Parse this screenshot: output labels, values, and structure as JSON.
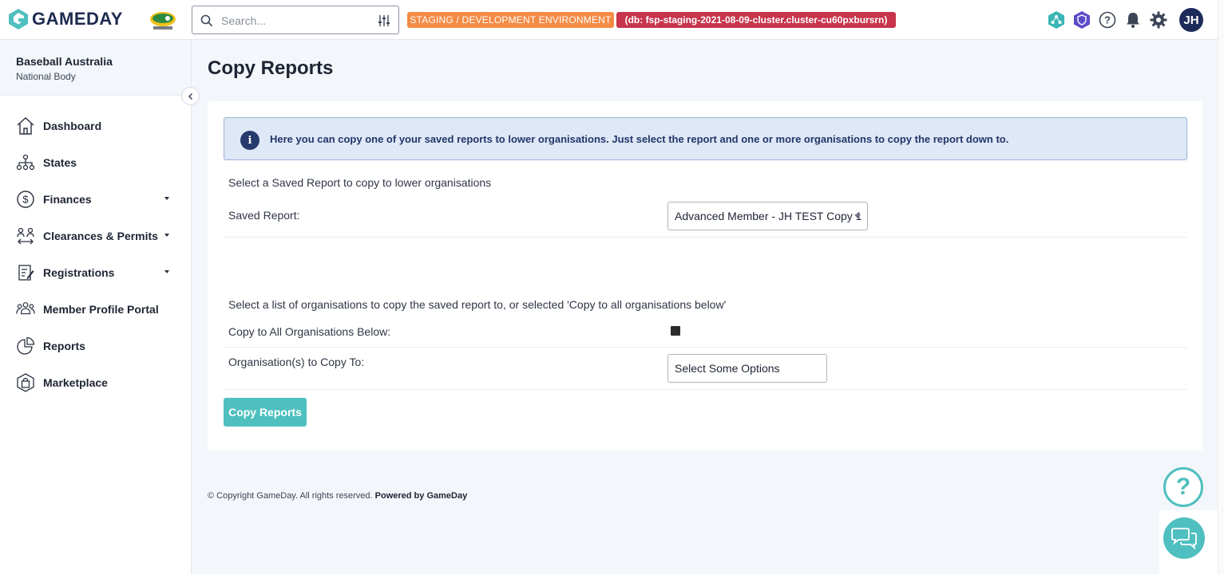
{
  "header": {
    "logo_text": "GAMEDAY",
    "search_placeholder": "Search...",
    "env_badge": "STAGING / DEVELOPMENT ENVIRONMENT",
    "db_badge": "(db: fsp-staging-2021-08-09-cluster.cluster-cu60pxbursrn)",
    "avatar_initials": "JH",
    "icons": [
      "network-icon",
      "shield-icon",
      "help-icon",
      "bell-icon",
      "gear-icon"
    ]
  },
  "sidebar": {
    "org_name": "Baseball Australia",
    "org_level": "National Body",
    "items": [
      {
        "label": "Dashboard",
        "icon": "home-icon",
        "has_caret": false
      },
      {
        "label": "States",
        "icon": "hierarchy-icon",
        "has_caret": false
      },
      {
        "label": "Finances",
        "icon": "dollar-icon",
        "has_caret": true
      },
      {
        "label": "Clearances & Permits",
        "icon": "transfer-people-icon",
        "has_caret": true
      },
      {
        "label": "Registrations",
        "icon": "form-icon",
        "has_caret": true
      },
      {
        "label": "Member Profile Portal",
        "icon": "people-group-icon",
        "has_caret": false
      },
      {
        "label": "Reports",
        "icon": "pie-chart-icon",
        "has_caret": false
      },
      {
        "label": "Marketplace",
        "icon": "shopping-bag-icon",
        "has_caret": false
      }
    ]
  },
  "main": {
    "title": "Copy Reports",
    "info_text": "Here you can copy one of your saved reports to lower organisations. Just select the report and one or more organisations to copy the report down to.",
    "section1_lead": "Select a Saved Report to copy to lower organisations",
    "saved_report_label": "Saved Report:",
    "saved_report_value": "Advanced Member - JH TEST Copy 1",
    "section2_lead": "Select a list of organisations to copy the saved report to, or selected 'Copy to all organisations below'",
    "copy_all_label": "Copy to All Organisations Below:",
    "copy_all_checked": true,
    "orgs_label": "Organisation(s) to Copy To:",
    "orgs_placeholder": "Select Some Options",
    "submit_label": "Copy Reports"
  },
  "footer": {
    "copyright": "©  Copyright GameDay. All rights reserved.",
    "powered": "Powered by GameDay"
  },
  "colors": {
    "accent": "#4fbfbf",
    "env_badge": "#f58b45",
    "db_badge": "#c7344c",
    "navy": "#1d2b5a"
  }
}
